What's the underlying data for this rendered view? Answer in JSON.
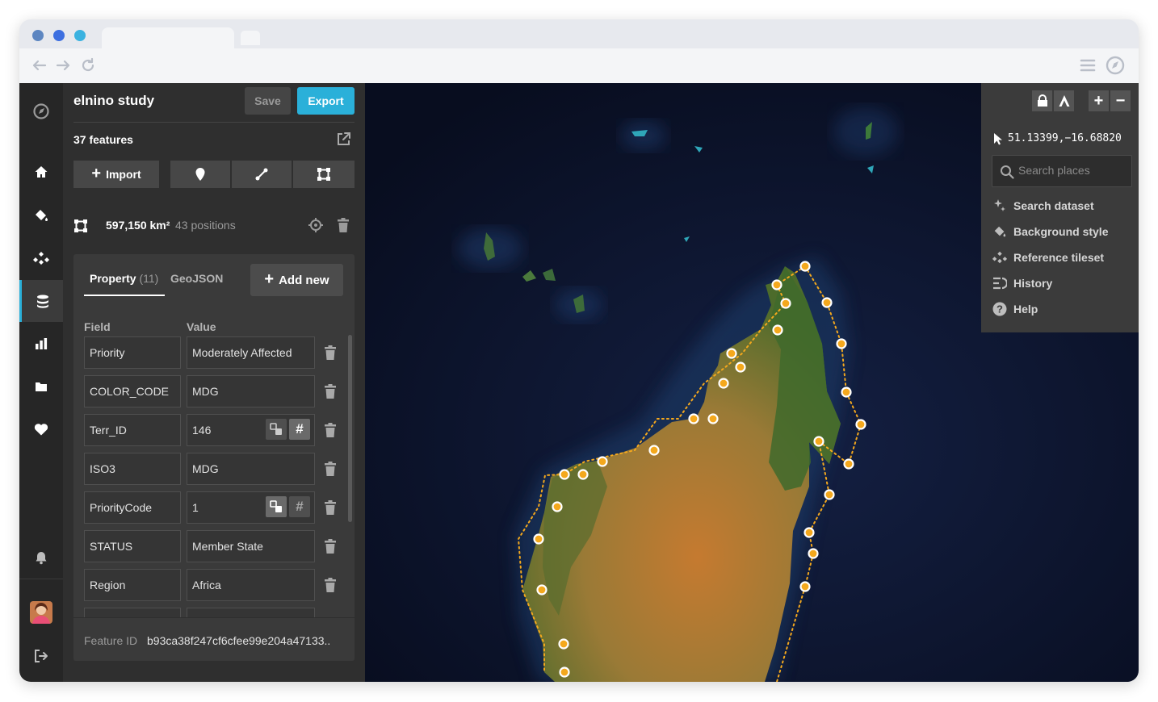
{
  "browser": {
    "traffic_colors": [
      "#5d86c1",
      "#3d6fe0",
      "#3ab2e0"
    ]
  },
  "rail": {
    "items": [
      "logo",
      "home",
      "style",
      "tileset",
      "data",
      "charts",
      "files",
      "favorites"
    ],
    "bottom": [
      "notifications",
      "avatar",
      "logout"
    ]
  },
  "panel": {
    "title": "elnino study",
    "save_label": "Save",
    "export_label": "Export",
    "feature_count": "37 features",
    "import_label": "Import",
    "shape_area": "597,150 km²",
    "shape_positions": "43 positions",
    "tabs": {
      "property_label": "Property",
      "property_count": "(11)",
      "geojson_label": "GeoJSON"
    },
    "add_new_label": "Add new",
    "field_header": "Field",
    "value_header": "Value",
    "properties": [
      {
        "field": "Priority",
        "value": "Moderately Affected"
      },
      {
        "field": "COLOR_CODE",
        "value": "MDG"
      },
      {
        "field": "Terr_ID",
        "value": "146"
      },
      {
        "field": "ISO3",
        "value": "MDG"
      },
      {
        "field": "PriorityCode",
        "value": "1"
      },
      {
        "field": "STATUS",
        "value": "Member State"
      },
      {
        "field": "Region",
        "value": "Africa"
      }
    ],
    "feature_id_label": "Feature ID",
    "feature_id": "b93ca38f247cf6cfee99e204a47133.."
  },
  "map_controls": {
    "coordinates": "51.13399,−16.68820",
    "search_placeholder": "Search places",
    "menu": [
      "Search dataset",
      "Background style",
      "Reference tileset",
      "History",
      "Help"
    ]
  },
  "colors": {
    "accent": "#2ab0d9",
    "vertex": "#f4a81d",
    "ocean": "#0b1126"
  }
}
